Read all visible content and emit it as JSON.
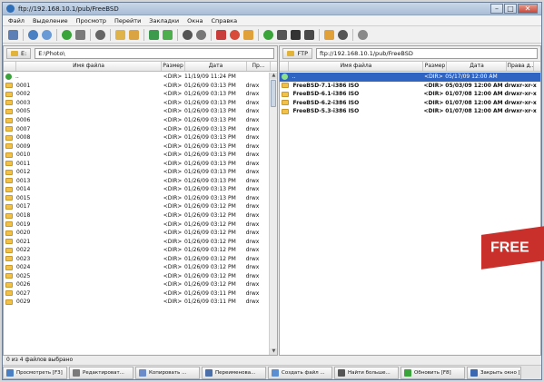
{
  "window": {
    "title": "ftp://192.168.10.1/pub/FreeBSD"
  },
  "menu": [
    "Файл",
    "Выделение",
    "Просмотр",
    "Перейти",
    "Закладки",
    "Окна",
    "Справка"
  ],
  "left_panel": {
    "drive": "E:",
    "path": "E:\\Photo\\",
    "columns": [
      "",
      "Имя файла",
      "Размер",
      "Дата",
      "Пр..."
    ],
    "rows": [
      {
        "name": "..",
        "size": "<DIR>",
        "date": "11/19/09 11:24 PM",
        "attr": "",
        "up": true
      },
      {
        "name": "0001",
        "size": "<DIR>",
        "date": "01/26/09 03:13 PM",
        "attr": "drwx"
      },
      {
        "name": "0002",
        "size": "<DIR>",
        "date": "01/26/09 03:13 PM",
        "attr": "drwx"
      },
      {
        "name": "0003",
        "size": "<DIR>",
        "date": "01/26/09 03:13 PM",
        "attr": "drwx"
      },
      {
        "name": "0005",
        "size": "<DIR>",
        "date": "01/26/09 03:13 PM",
        "attr": "drwx"
      },
      {
        "name": "0006",
        "size": "<DIR>",
        "date": "01/26/09 03:13 PM",
        "attr": "drwx"
      },
      {
        "name": "0007",
        "size": "<DIR>",
        "date": "01/26/09 03:13 PM",
        "attr": "drwx"
      },
      {
        "name": "0008",
        "size": "<DIR>",
        "date": "01/26/09 03:13 PM",
        "attr": "drwx"
      },
      {
        "name": "0009",
        "size": "<DIR>",
        "date": "01/26/09 03:13 PM",
        "attr": "drwx"
      },
      {
        "name": "0010",
        "size": "<DIR>",
        "date": "01/26/09 03:13 PM",
        "attr": "drwx"
      },
      {
        "name": "0011",
        "size": "<DIR>",
        "date": "01/26/09 03:13 PM",
        "attr": "drwx"
      },
      {
        "name": "0012",
        "size": "<DIR>",
        "date": "01/26/09 03:13 PM",
        "attr": "drwx"
      },
      {
        "name": "0013",
        "size": "<DIR>",
        "date": "01/26/09 03:13 PM",
        "attr": "drwx"
      },
      {
        "name": "0014",
        "size": "<DIR>",
        "date": "01/26/09 03:13 PM",
        "attr": "drwx"
      },
      {
        "name": "0015",
        "size": "<DIR>",
        "date": "01/26/09 03:13 PM",
        "attr": "drwx"
      },
      {
        "name": "0017",
        "size": "<DIR>",
        "date": "01/26/09 03:12 PM",
        "attr": "drwx"
      },
      {
        "name": "0018",
        "size": "<DIR>",
        "date": "01/26/09 03:12 PM",
        "attr": "drwx"
      },
      {
        "name": "0019",
        "size": "<DIR>",
        "date": "01/26/09 03:12 PM",
        "attr": "drwx"
      },
      {
        "name": "0020",
        "size": "<DIR>",
        "date": "01/26/09 03:12 PM",
        "attr": "drwx"
      },
      {
        "name": "0021",
        "size": "<DIR>",
        "date": "01/26/09 03:12 PM",
        "attr": "drwx"
      },
      {
        "name": "0022",
        "size": "<DIR>",
        "date": "01/26/09 03:12 PM",
        "attr": "drwx"
      },
      {
        "name": "0023",
        "size": "<DIR>",
        "date": "01/26/09 03:12 PM",
        "attr": "drwx"
      },
      {
        "name": "0024",
        "size": "<DIR>",
        "date": "01/26/09 03:12 PM",
        "attr": "drwx"
      },
      {
        "name": "0025",
        "size": "<DIR>",
        "date": "01/26/09 03:12 PM",
        "attr": "drwx"
      },
      {
        "name": "0026",
        "size": "<DIR>",
        "date": "01/26/09 03:12 PM",
        "attr": "drwx"
      },
      {
        "name": "0027",
        "size": "<DIR>",
        "date": "01/26/09 03:11 PM",
        "attr": "drwx"
      },
      {
        "name": "0029",
        "size": "<DIR>",
        "date": "01/26/09 03:11 PM",
        "attr": "drwx"
      }
    ]
  },
  "right_panel": {
    "drive": "FTP",
    "path": "ftp://192.168.10.1/pub/FreeBSD",
    "columns": [
      "",
      "Имя файла",
      "Размер",
      "Дата",
      "Права д..."
    ],
    "rows": [
      {
        "name": "..",
        "size": "<DIR>",
        "date": "05/17/09 12:00 AM",
        "attr": "",
        "up": true,
        "selected": true
      },
      {
        "name": "FreeBSD-7.1-i386 ISO",
        "size": "<DIR>",
        "date": "05/03/09 12:00 AM",
        "attr": "drwxr-xr-x"
      },
      {
        "name": "FreeBSD-6.1-i386 ISO",
        "size": "<DIR>",
        "date": "01/07/08 12:00 AM",
        "attr": "drwxr-xr-x"
      },
      {
        "name": "FreeBSD-6.2-i386 ISO",
        "size": "<DIR>",
        "date": "01/07/08 12:00 AM",
        "attr": "drwxr-xr-x"
      },
      {
        "name": "FreeBSD-5.3-i386 ISO",
        "size": "<DIR>",
        "date": "01/07/08 12:00 AM",
        "attr": "drwxr-xr-x"
      }
    ]
  },
  "status": {
    "text": "0 из 4 файлов выбрано"
  },
  "function_keys": [
    {
      "label": "Просмотреть [F3]",
      "color": "#4a7fc4"
    },
    {
      "label": "Редактироват...",
      "color": "#7a7a7a"
    },
    {
      "label": "Копировать ...",
      "color": "#6b8cc8"
    },
    {
      "label": "Переименова...",
      "color": "#4b6fa8"
    },
    {
      "label": "Создать файл ...",
      "color": "#5b8fd1"
    },
    {
      "label": "Найти больше...",
      "color": "#555555"
    },
    {
      "label": "Обновить [F8]",
      "color": "#3aa33a"
    },
    {
      "label": "Закрыть окно [...",
      "color": "#3b68b0"
    }
  ],
  "promo": {
    "text": "FREE"
  },
  "colors": {
    "selection": "#2f64c2",
    "folder": "#f0c24a",
    "promo": "#c9302c"
  }
}
